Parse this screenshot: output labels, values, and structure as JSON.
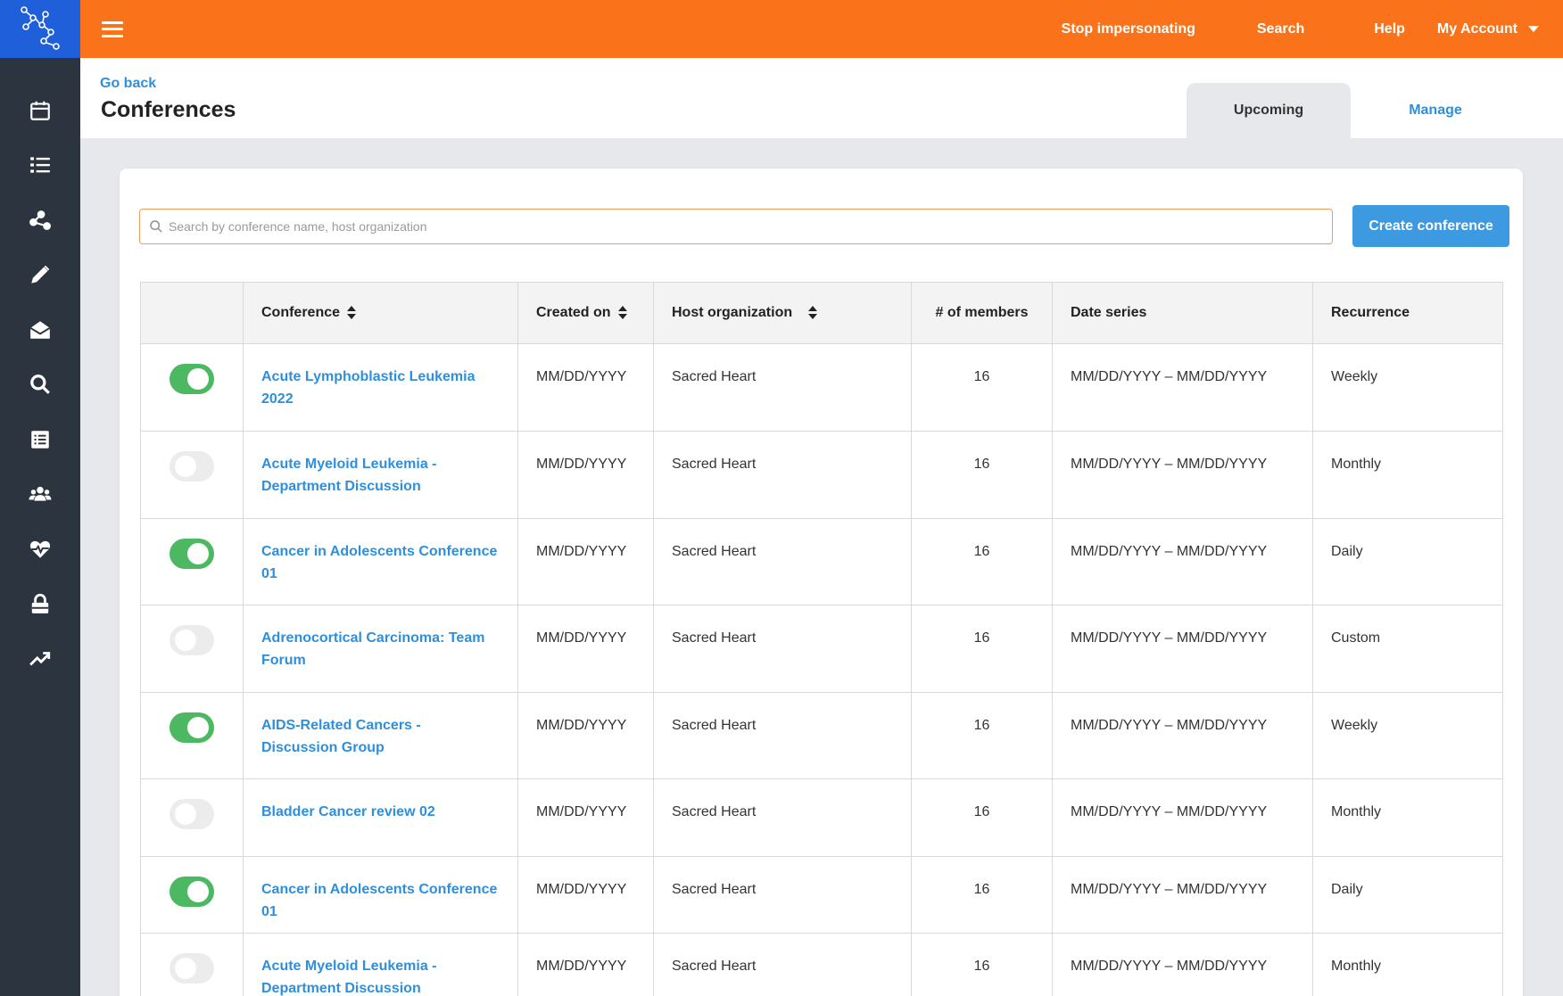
{
  "topbar": {
    "links": [
      "Stop impersonating",
      "Search",
      "Help"
    ],
    "account_label": "My Account",
    "accent_color": "#fa7219"
  },
  "sidebar": {
    "logo_color": "#1f5fd9",
    "icons": [
      "calendar-icon",
      "list-icon",
      "share-icon",
      "pencil-icon",
      "mail-icon",
      "search-icon",
      "document-list-icon",
      "users-icon",
      "heart-pulse-icon",
      "lock-icon",
      "trending-icon"
    ]
  },
  "header": {
    "back_label": "Go back",
    "title": "Conferences",
    "tabs": [
      {
        "label": "Upcoming",
        "active": true
      },
      {
        "label": "Manage",
        "active": false
      }
    ]
  },
  "search": {
    "placeholder": "Search by conference name, host organization",
    "value": ""
  },
  "create_button": "Create conference",
  "table": {
    "columns": [
      "",
      "Conference",
      "Created on",
      "Host organization",
      "# of members",
      "Date series",
      "Recurrence"
    ],
    "rows": [
      {
        "enabled": true,
        "conference": "Acute Lymphoblastic Leukemia 2022",
        "created": "MM/DD/YYYY",
        "host": "Sacred Heart",
        "members": "16",
        "dates": "MM/DD/YYYY – MM/DD/YYYY",
        "recurrence": "Weekly"
      },
      {
        "enabled": false,
        "conference": "Acute Myeloid Leukemia - Department Discussion",
        "created": "MM/DD/YYYY",
        "host": "Sacred Heart",
        "members": "16",
        "dates": "MM/DD/YYYY – MM/DD/YYYY",
        "recurrence": "Monthly"
      },
      {
        "enabled": true,
        "conference": "Cancer in Adolescents Conference 01",
        "created": "MM/DD/YYYY",
        "host": "Sacred Heart",
        "members": "16",
        "dates": "MM/DD/YYYY – MM/DD/YYYY",
        "recurrence": "Daily"
      },
      {
        "enabled": false,
        "conference": "Adrenocortical Carcinoma: Team Forum",
        "created": "MM/DD/YYYY",
        "host": "Sacred Heart",
        "members": "16",
        "dates": "MM/DD/YYYY – MM/DD/YYYY",
        "recurrence": "Custom"
      },
      {
        "enabled": true,
        "conference": "AIDS-Related Cancers - Discussion Group",
        "created": "MM/DD/YYYY",
        "host": "Sacred Heart",
        "members": "16",
        "dates": "MM/DD/YYYY – MM/DD/YYYY",
        "recurrence": "Weekly"
      },
      {
        "enabled": false,
        "conference": "Bladder Cancer review 02",
        "created": "MM/DD/YYYY",
        "host": "Sacred Heart",
        "members": "16",
        "dates": "MM/DD/YYYY – MM/DD/YYYY",
        "recurrence": "Monthly"
      },
      {
        "enabled": true,
        "conference": "Cancer in Adolescents Conference 01",
        "created": "MM/DD/YYYY",
        "host": "Sacred Heart",
        "members": "16",
        "dates": "MM/DD/YYYY – MM/DD/YYYY",
        "recurrence": "Daily"
      },
      {
        "enabled": false,
        "conference": "Acute Myeloid Leukemia - Department Discussion",
        "created": "MM/DD/YYYY",
        "host": "Sacred Heart",
        "members": "16",
        "dates": "MM/DD/YYYY – MM/DD/YYYY",
        "recurrence": "Monthly"
      }
    ]
  }
}
